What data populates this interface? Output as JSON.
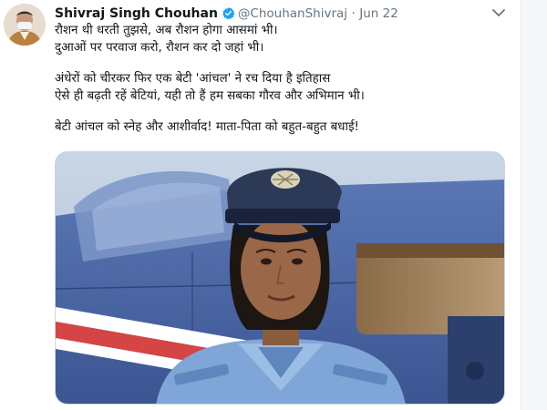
{
  "tweet": {
    "author_name": "Shivraj Singh Chouhan",
    "handle": "@ChouhanShivraj",
    "separator": "·",
    "date": "Jun 22",
    "lines": [
      "रौशन थी धरती तुझसे, अब रौशन होगा आसमां भी।",
      "दुआओं पर परवाज करो, रौशन कर दो जहां भी।",
      "अंधेरों को चीरकर फिर एक बेटी 'आंचल' ने रच दिया है इतिहास",
      "ऐसे ही बढ़ती रहें बेटियां, यही तो हैं हम सबका गौरव और अभिमान भी।",
      "बेटी आंचल को स्नेह और आशीर्वाद! माता-पिता को बहुत-बहुत बधाई!"
    ]
  },
  "icons": {
    "verified": "verified-badge-icon",
    "more": "chevron-down-icon"
  },
  "colors": {
    "verified": "#1da1f2",
    "muted": "#657786",
    "text": "#14171a",
    "border": "#ccd6dd"
  }
}
